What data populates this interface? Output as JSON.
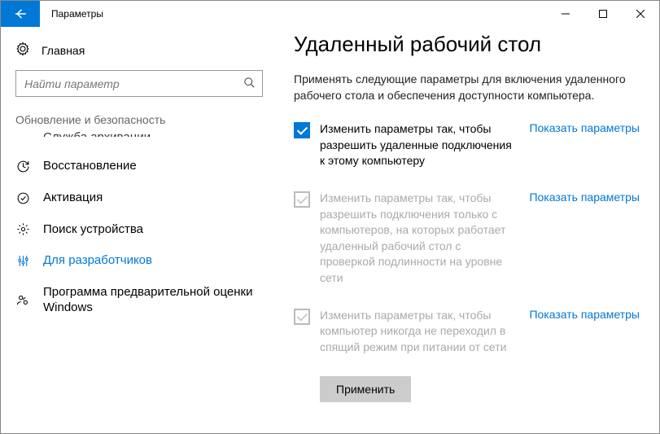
{
  "window": {
    "title": "Параметры"
  },
  "sidebar": {
    "home_label": "Главная",
    "search_placeholder": "Найти параметр",
    "group_label": "Обновление и безопасность",
    "items": [
      {
        "label": "Служба архивации",
        "truncated": true
      },
      {
        "label": "Восстановление"
      },
      {
        "label": "Активация"
      },
      {
        "label": "Поиск устройства"
      },
      {
        "label": "Для разработчиков",
        "active": true
      },
      {
        "label": "Программа предварительной оценки Windows"
      }
    ]
  },
  "main": {
    "heading": "Удаленный рабочий стол",
    "description": "Применять следующие параметры для включения удаленного рабочего стола и обеспечения доступности компьютера.",
    "show_params_label": "Показать параметры",
    "apply_label": "Применить",
    "settings": [
      {
        "text": "Изменить параметры так, чтобы разрешить удаленные подключения к этому компьютеру",
        "checked": true,
        "enabled": true
      },
      {
        "text": "Изменить параметры так, чтобы разрешить подключения только с компьютеров, на которых работает удаленный рабочий стол с проверкой подлинности на уровне сети",
        "checked": true,
        "enabled": false
      },
      {
        "text": "Изменить параметры так, чтобы компьютер никогда не переходил в спящий режим при питании от сети",
        "checked": true,
        "enabled": false
      }
    ]
  }
}
